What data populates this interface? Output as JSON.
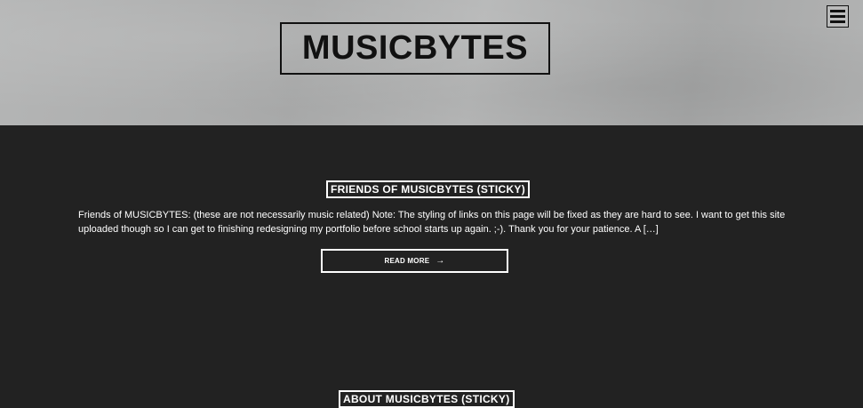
{
  "header": {
    "site_title": "MUSICBYTES"
  },
  "menu": {
    "icon": "hamburger-menu-icon"
  },
  "posts": [
    {
      "title": "FRIENDS OF MUSICBYTES (STICKY)",
      "excerpt": "Friends of MUSICBYTES: (these are not necessarily music related) Note: The styling of links on this page will be fixed as they are hard to see. I want to get this site uploaded though so I can get to finishing redesigning my portfolio before school starts up again. ;-). Thank you for your patience. A […]",
      "read_more_label": "READ MORE",
      "read_more_arrow": "→"
    },
    {
      "title": "ABOUT MUSICBYTES (STICKY)"
    }
  ],
  "colors": {
    "background": "#222222",
    "header_background": "#aeafaf",
    "text_light": "#ffffff",
    "text_dark": "#111111"
  }
}
